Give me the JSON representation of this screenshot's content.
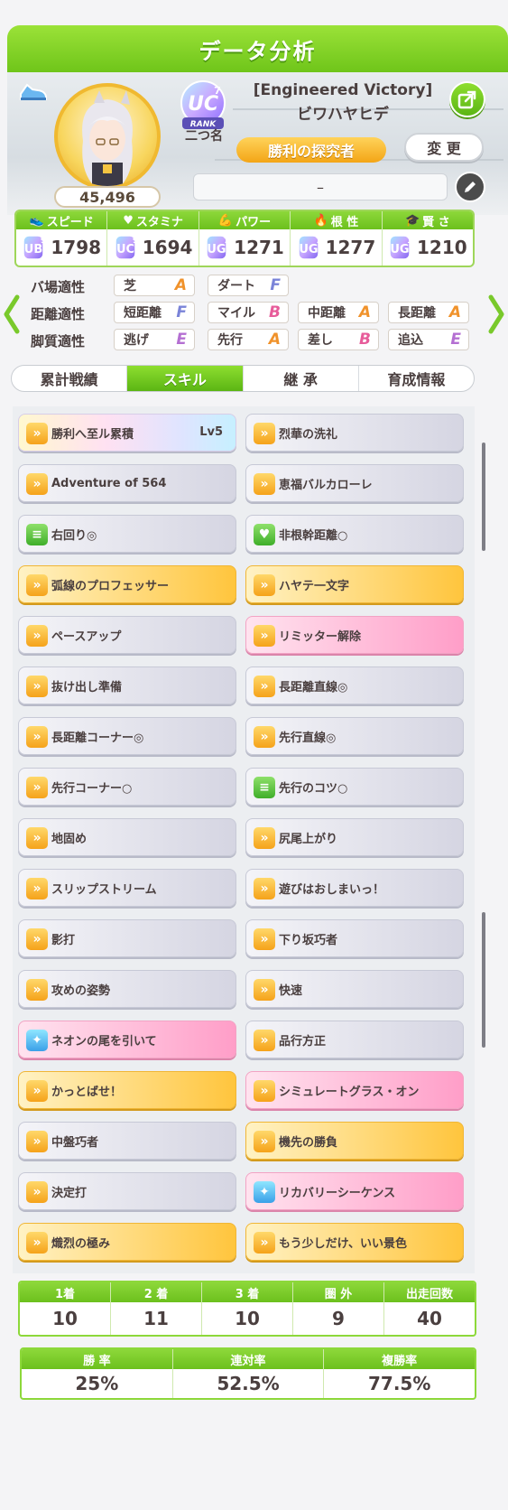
{
  "header": {
    "title": "データ分析"
  },
  "profile": {
    "score": "45,496",
    "rank": {
      "grade": "UC",
      "subrank": "7",
      "rank_label": "RANK"
    },
    "rank_caption": "二つ名",
    "title_en": "[Engineered Victory]",
    "name": "ビワハヤヒデ",
    "epithet": "勝利の探究者",
    "change_label": "変 更",
    "trainer_field": "–"
  },
  "stats": [
    {
      "label": "スピード",
      "grade": "UB",
      "sub": "9",
      "value": "1798"
    },
    {
      "label": "スタミナ",
      "grade": "UC",
      "sub": "9",
      "value": "1694"
    },
    {
      "label": "パワー",
      "grade": "UG",
      "sub": "7",
      "value": "1271"
    },
    {
      "label": "根 性",
      "grade": "UG",
      "sub": "7",
      "value": "1277"
    },
    {
      "label": "賢 さ",
      "grade": "UG",
      "sub": "1",
      "value": "1210"
    }
  ],
  "aptitude": [
    {
      "label": "バ場適性",
      "items": [
        {
          "name": "芝",
          "grade": "A"
        },
        {
          "name": "ダート",
          "grade": "F"
        }
      ]
    },
    {
      "label": "距離適性",
      "items": [
        {
          "name": "短距離",
          "grade": "F"
        },
        {
          "name": "マイル",
          "grade": "B"
        },
        {
          "name": "中距離",
          "grade": "A"
        },
        {
          "name": "長距離",
          "grade": "A"
        }
      ]
    },
    {
      "label": "脚質適性",
      "items": [
        {
          "name": "逃げ",
          "grade": "E"
        },
        {
          "name": "先行",
          "grade": "A"
        },
        {
          "name": "差し",
          "grade": "B"
        },
        {
          "name": "追込",
          "grade": "E"
        }
      ]
    }
  ],
  "grade_colors": {
    "A": "#f0922b",
    "B": "#e75c9a",
    "E": "#b46fd2",
    "F": "#7a83d8"
  },
  "tabs": [
    {
      "label": "累計戦績",
      "active": false
    },
    {
      "label": "スキル",
      "active": true
    },
    {
      "label": "継 承",
      "active": false
    },
    {
      "label": "育成情報",
      "active": false
    }
  ],
  "skills": [
    {
      "name": "勝利へ至ル累積",
      "style": "rainbow",
      "icon": "speed-icon",
      "level": "Lv5"
    },
    {
      "name": "烈華の洗礼",
      "style": "normal",
      "icon": "speed-icon"
    },
    {
      "name": "Adventure of 564",
      "style": "normal",
      "icon": "speed-icon"
    },
    {
      "name": "恵福バルカローレ",
      "style": "normal",
      "icon": "speed-icon"
    },
    {
      "name": "右回り◎",
      "style": "normal",
      "icon": "passive-green-icon"
    },
    {
      "name": "非根幹距離○",
      "style": "normal",
      "icon": "heart-icon"
    },
    {
      "name": "弧線のプロフェッサー",
      "style": "gold",
      "icon": "speed-icon"
    },
    {
      "name": "ハヤテ一文字",
      "style": "gold",
      "icon": "speed-icon"
    },
    {
      "name": "ペースアップ",
      "style": "normal",
      "icon": "speed-icon"
    },
    {
      "name": "リミッター解除",
      "style": "pink",
      "icon": "speed-icon"
    },
    {
      "name": "抜け出し準備",
      "style": "normal",
      "icon": "speed-icon"
    },
    {
      "name": "長距離直線◎",
      "style": "normal",
      "icon": "speed-icon"
    },
    {
      "name": "長距離コーナー◎",
      "style": "normal",
      "icon": "speed-icon"
    },
    {
      "name": "先行直線◎",
      "style": "normal",
      "icon": "speed-icon"
    },
    {
      "name": "先行コーナー○",
      "style": "normal",
      "icon": "speed-icon"
    },
    {
      "name": "先行のコツ○",
      "style": "normal",
      "icon": "passive-green-icon"
    },
    {
      "name": "地固め",
      "style": "normal",
      "icon": "speed-icon"
    },
    {
      "name": "尻尾上がり",
      "style": "normal",
      "icon": "speed-icon"
    },
    {
      "name": "スリップストリーム",
      "style": "normal",
      "icon": "speed-icon"
    },
    {
      "name": "遊びはおしまいっ！",
      "style": "normal",
      "icon": "speed-icon"
    },
    {
      "name": "影打",
      "style": "normal",
      "icon": "speed-icon"
    },
    {
      "name": "下り坂巧者",
      "style": "normal",
      "icon": "speed-icon"
    },
    {
      "name": "攻めの姿勢",
      "style": "normal",
      "icon": "speed-icon"
    },
    {
      "name": "快速",
      "style": "normal",
      "icon": "speed-icon"
    },
    {
      "name": "ネオンの尾を引いて",
      "style": "pink",
      "icon": "recovery-icon"
    },
    {
      "name": "品行方正",
      "style": "normal",
      "icon": "speed-icon"
    },
    {
      "name": "かっとばせ！",
      "style": "gold",
      "icon": "speed-icon"
    },
    {
      "name": "シミュレートグラス・オン",
      "style": "pink",
      "icon": "speed-icon"
    },
    {
      "name": "中盤巧者",
      "style": "normal",
      "icon": "speed-icon"
    },
    {
      "name": "機先の勝負",
      "style": "gold",
      "icon": "speed-icon"
    },
    {
      "name": "決定打",
      "style": "normal",
      "icon": "speed-icon"
    },
    {
      "name": "リカバリーシーケンス",
      "style": "pink",
      "icon": "recovery-icon"
    },
    {
      "name": "熾烈の極み",
      "style": "gold",
      "icon": "speed-icon"
    },
    {
      "name": "もう少しだけ、いい景色",
      "style": "gold",
      "icon": "speed-icon"
    }
  ],
  "results": [
    {
      "label": "1着",
      "value": "10"
    },
    {
      "label": "2 着",
      "value": "11"
    },
    {
      "label": "3 着",
      "value": "10"
    },
    {
      "label": "圏 外",
      "value": "9"
    },
    {
      "label": "出走回数",
      "value": "40"
    }
  ],
  "rates": [
    {
      "label": "勝 率",
      "value": "25%"
    },
    {
      "label": "連対率",
      "value": "52.5%"
    },
    {
      "label": "複勝率",
      "value": "77.5%"
    }
  ]
}
